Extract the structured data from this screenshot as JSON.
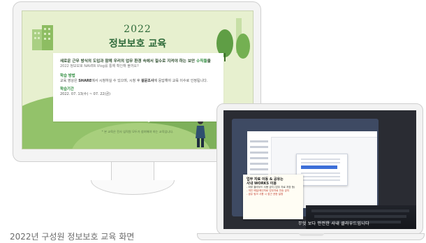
{
  "monitor": {
    "heading_year": "2022",
    "heading_title": "정보보호 교육",
    "card": {
      "lead_prefix": "새로운 근무 방식의 도입과 함께 우리의 업무 환경 속에서 필수로 지켜야 하는 보안 ",
      "lead_highlight": "수칙들",
      "lead_suffix": "을",
      "sub": "2022 정보보호 NAVER Vlog를 통해 확인해 볼까요?",
      "method_heading": "학습 방법",
      "method_text_1": "교육 영상은 ",
      "method_share": "SHARE",
      "method_text_2": "에서 시청하실 수 있으며, 시청 후 ",
      "method_survey": "설문조사",
      "method_text_3": "에 응답해야 교육 이수로 인정됩니다.",
      "period_heading": "학습기간",
      "period_text": "2022. 07. 13(수) ~ 07. 22(금)"
    },
    "note": "* 본 교육은 전사 임직원 모두가 참여해야 하는 교육입니다."
  },
  "laptop": {
    "note_title_1": "업무 자료 이동 & 공유는",
    "note_title_2": "사내 WORKS 이용",
    "note_lines": [
      "- 외부 클라우드 사용 금지 (업무 자료 저장 등)",
      "- 개인 메일/메신저로 업무자료 전송 금지",
      "- 공유 링크 사용 시 접근 권한 설정"
    ],
    "subtitle": "무엇 보다 안전한 사내 클라우드입니다"
  },
  "caption": "2022년 구성원 정보보호 교육 화면",
  "colors": {
    "accent_green": "#2e8b3e",
    "hill": "#93c26a",
    "screen_bg": "#e7f0cf"
  }
}
